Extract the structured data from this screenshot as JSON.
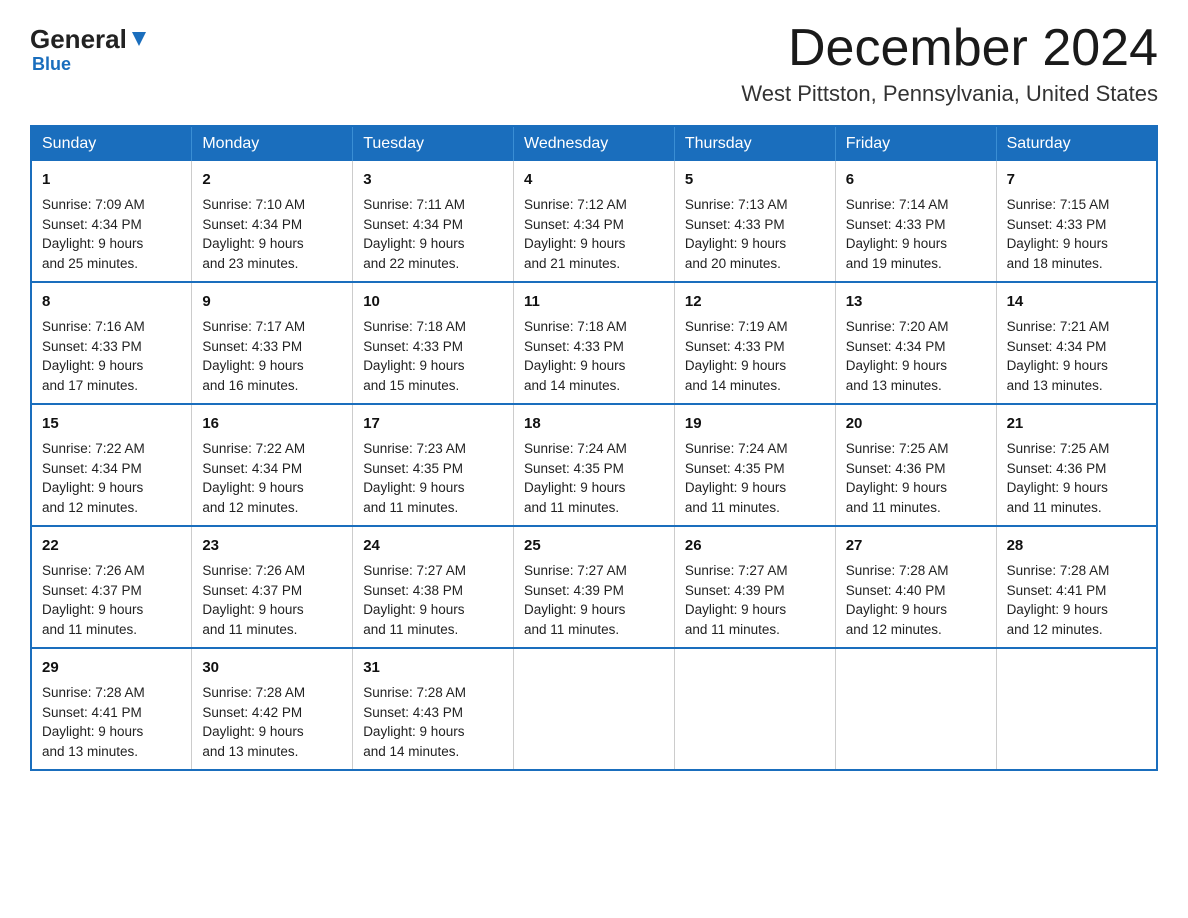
{
  "logo": {
    "general": "General",
    "blue": "Blue"
  },
  "header": {
    "month": "December 2024",
    "location": "West Pittston, Pennsylvania, United States"
  },
  "days_of_week": [
    "Sunday",
    "Monday",
    "Tuesday",
    "Wednesday",
    "Thursday",
    "Friday",
    "Saturday"
  ],
  "weeks": [
    [
      {
        "day": "1",
        "sunrise": "7:09 AM",
        "sunset": "4:34 PM",
        "daylight": "9 hours and 25 minutes."
      },
      {
        "day": "2",
        "sunrise": "7:10 AM",
        "sunset": "4:34 PM",
        "daylight": "9 hours and 23 minutes."
      },
      {
        "day": "3",
        "sunrise": "7:11 AM",
        "sunset": "4:34 PM",
        "daylight": "9 hours and 22 minutes."
      },
      {
        "day": "4",
        "sunrise": "7:12 AM",
        "sunset": "4:34 PM",
        "daylight": "9 hours and 21 minutes."
      },
      {
        "day": "5",
        "sunrise": "7:13 AM",
        "sunset": "4:33 PM",
        "daylight": "9 hours and 20 minutes."
      },
      {
        "day": "6",
        "sunrise": "7:14 AM",
        "sunset": "4:33 PM",
        "daylight": "9 hours and 19 minutes."
      },
      {
        "day": "7",
        "sunrise": "7:15 AM",
        "sunset": "4:33 PM",
        "daylight": "9 hours and 18 minutes."
      }
    ],
    [
      {
        "day": "8",
        "sunrise": "7:16 AM",
        "sunset": "4:33 PM",
        "daylight": "9 hours and 17 minutes."
      },
      {
        "day": "9",
        "sunrise": "7:17 AM",
        "sunset": "4:33 PM",
        "daylight": "9 hours and 16 minutes."
      },
      {
        "day": "10",
        "sunrise": "7:18 AM",
        "sunset": "4:33 PM",
        "daylight": "9 hours and 15 minutes."
      },
      {
        "day": "11",
        "sunrise": "7:18 AM",
        "sunset": "4:33 PM",
        "daylight": "9 hours and 14 minutes."
      },
      {
        "day": "12",
        "sunrise": "7:19 AM",
        "sunset": "4:33 PM",
        "daylight": "9 hours and 14 minutes."
      },
      {
        "day": "13",
        "sunrise": "7:20 AM",
        "sunset": "4:34 PM",
        "daylight": "9 hours and 13 minutes."
      },
      {
        "day": "14",
        "sunrise": "7:21 AM",
        "sunset": "4:34 PM",
        "daylight": "9 hours and 13 minutes."
      }
    ],
    [
      {
        "day": "15",
        "sunrise": "7:22 AM",
        "sunset": "4:34 PM",
        "daylight": "9 hours and 12 minutes."
      },
      {
        "day": "16",
        "sunrise": "7:22 AM",
        "sunset": "4:34 PM",
        "daylight": "9 hours and 12 minutes."
      },
      {
        "day": "17",
        "sunrise": "7:23 AM",
        "sunset": "4:35 PM",
        "daylight": "9 hours and 11 minutes."
      },
      {
        "day": "18",
        "sunrise": "7:24 AM",
        "sunset": "4:35 PM",
        "daylight": "9 hours and 11 minutes."
      },
      {
        "day": "19",
        "sunrise": "7:24 AM",
        "sunset": "4:35 PM",
        "daylight": "9 hours and 11 minutes."
      },
      {
        "day": "20",
        "sunrise": "7:25 AM",
        "sunset": "4:36 PM",
        "daylight": "9 hours and 11 minutes."
      },
      {
        "day": "21",
        "sunrise": "7:25 AM",
        "sunset": "4:36 PM",
        "daylight": "9 hours and 11 minutes."
      }
    ],
    [
      {
        "day": "22",
        "sunrise": "7:26 AM",
        "sunset": "4:37 PM",
        "daylight": "9 hours and 11 minutes."
      },
      {
        "day": "23",
        "sunrise": "7:26 AM",
        "sunset": "4:37 PM",
        "daylight": "9 hours and 11 minutes."
      },
      {
        "day": "24",
        "sunrise": "7:27 AM",
        "sunset": "4:38 PM",
        "daylight": "9 hours and 11 minutes."
      },
      {
        "day": "25",
        "sunrise": "7:27 AM",
        "sunset": "4:39 PM",
        "daylight": "9 hours and 11 minutes."
      },
      {
        "day": "26",
        "sunrise": "7:27 AM",
        "sunset": "4:39 PM",
        "daylight": "9 hours and 11 minutes."
      },
      {
        "day": "27",
        "sunrise": "7:28 AM",
        "sunset": "4:40 PM",
        "daylight": "9 hours and 12 minutes."
      },
      {
        "day": "28",
        "sunrise": "7:28 AM",
        "sunset": "4:41 PM",
        "daylight": "9 hours and 12 minutes."
      }
    ],
    [
      {
        "day": "29",
        "sunrise": "7:28 AM",
        "sunset": "4:41 PM",
        "daylight": "9 hours and 13 minutes."
      },
      {
        "day": "30",
        "sunrise": "7:28 AM",
        "sunset": "4:42 PM",
        "daylight": "9 hours and 13 minutes."
      },
      {
        "day": "31",
        "sunrise": "7:28 AM",
        "sunset": "4:43 PM",
        "daylight": "9 hours and 14 minutes."
      },
      null,
      null,
      null,
      null
    ]
  ],
  "labels": {
    "sunrise": "Sunrise:",
    "sunset": "Sunset:",
    "daylight": "Daylight:"
  }
}
